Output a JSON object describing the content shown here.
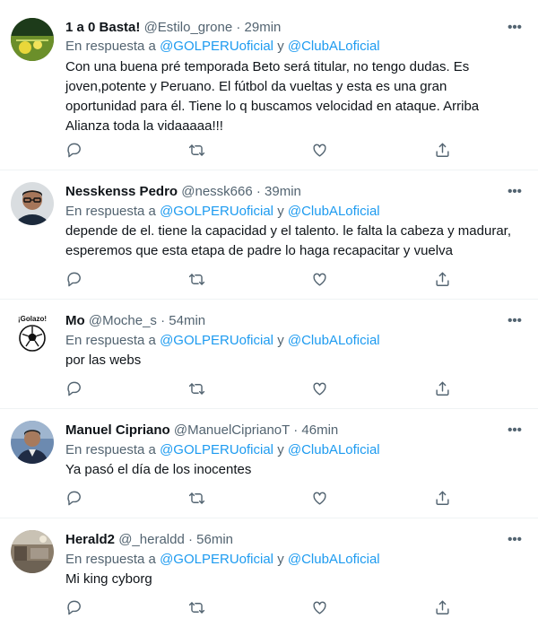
{
  "tweets": [
    {
      "name": "1 a 0 Basta!",
      "handle": "@Estilo_grone",
      "sep": "·",
      "time": "29min",
      "reply_prefix": "En respuesta a",
      "mention1": "@GOLPERUoficial",
      "conj": "y",
      "mention2": "@ClubALoficial",
      "lines": [
        "Con una buena pré temporada Beto será titular, no tengo dudas. Es",
        "joven,potente y Peruano. El fútbol da vueltas y esta es una gran",
        "oportunidad para él. Tiene lo q buscamos velocidad en ataque. Arriba",
        "Alianza toda la vidaaaaa!!!"
      ],
      "avatar_icon": "football-field-avatar-icon"
    },
    {
      "name": "Nesskenss Pedro",
      "handle": "@nessk666",
      "sep": "·",
      "time": "39min",
      "reply_prefix": "En respuesta a",
      "mention1": "@GOLPERUoficial",
      "conj": "y",
      "mention2": "@ClubALoficial",
      "lines": [
        "depende de el. tiene la capacidad y el talento. le falta la cabeza y madurar,",
        "esperemos que esta etapa de padre lo haga recapacitar y vuelva"
      ],
      "avatar_icon": "man-glasses-avatar-icon"
    },
    {
      "name": "Mo",
      "handle": "@Moche_s",
      "sep": "·",
      "time": "54min",
      "reply_prefix": "En respuesta a",
      "mention1": "@GOLPERUoficial",
      "conj": "y",
      "mention2": "@ClubALoficial",
      "lines": [
        "por las webs"
      ],
      "avatar_text": "¡Golazo!",
      "avatar_icon": "soccer-ball-avatar-icon"
    },
    {
      "name": "Manuel Cipriano",
      "handle": "@ManuelCiprianoT",
      "sep": "·",
      "time": "46min",
      "reply_prefix": "En respuesta a",
      "mention1": "@GOLPERUoficial",
      "conj": "y",
      "mention2": "@ClubALoficial",
      "lines": [
        "Ya pasó el día de los inocentes"
      ],
      "avatar_icon": "man-suit-avatar-icon"
    },
    {
      "name": "Herald2",
      "handle": "@_heraldd",
      "sep": "·",
      "time": "56min",
      "reply_prefix": "En respuesta a",
      "mention1": "@GOLPERUoficial",
      "conj": "y",
      "mention2": "@ClubALoficial",
      "lines": [
        "Mi king cyborg"
      ],
      "avatar_icon": "room-photo-avatar-icon"
    }
  ],
  "more_label": "•••",
  "colors": {
    "accent": "#1d9bf0",
    "secondary": "#536471",
    "text": "#0f1419"
  }
}
